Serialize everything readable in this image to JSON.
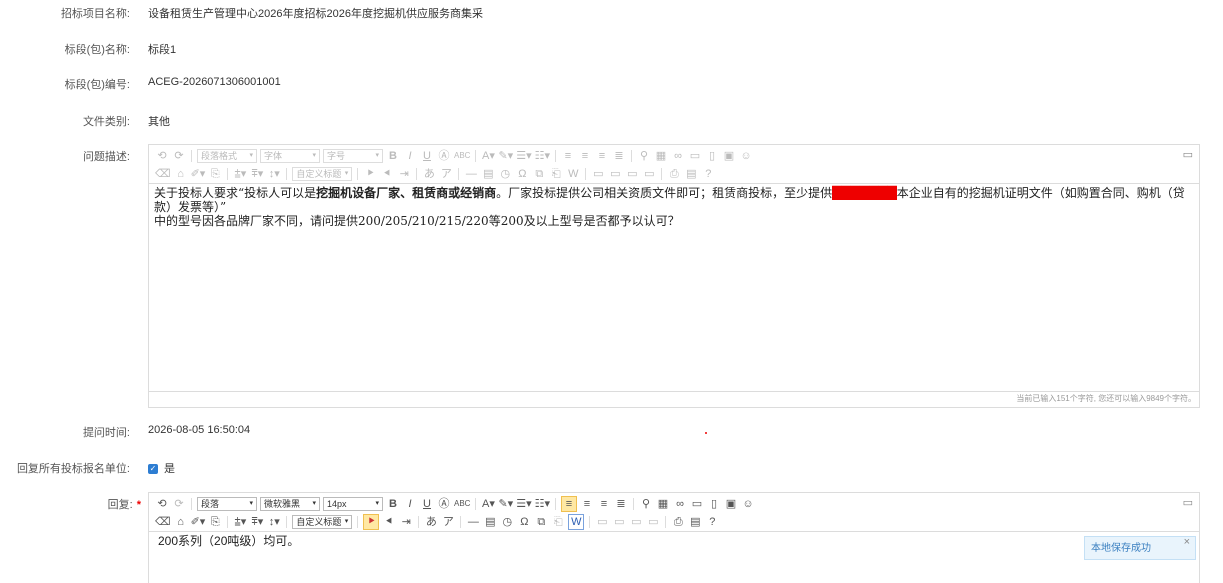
{
  "fields": {
    "project_name_label": "招标项目名称:",
    "project_name_value": "设备租赁生产管理中心2026年度招标2026年度挖掘机供应服务商集采",
    "section_name_label": "标段(包)名称:",
    "section_name_value": "标段1",
    "section_code_label": "标段(包)编号:",
    "section_code_value": "ACEG-2026071306001001",
    "file_type_label": "文件类别:",
    "file_type_value": "其他",
    "question_label": "问题描述:",
    "ask_time_label": "提问时间:",
    "ask_time_value": "2026-08-05 16:50:04",
    "reply_all_label": "回复所有投标报名单位:",
    "reply_all_value": "是",
    "reply_label": "回复:",
    "reply_required": "*"
  },
  "question_editor": {
    "toolbar": {
      "paragraph_placeholder": "段落格式",
      "font_placeholder": "字体",
      "size_placeholder": "字号",
      "custom_title": "自定义标题"
    },
    "content": {
      "part1": "关于投标人要求“投标人可以是",
      "bold": "挖掘机设备厂家、租赁商或经销商",
      "part2": "。厂家投标提供公司相关资质文件即可；租赁商投标，至少提供",
      "redacted": "███████",
      "part3": "本企业自有的挖掘机证明文件（如购置合同、购机（贷款）发票等）”",
      "line2": "中的型号因各品牌厂家不同，请问提供200/205/210/215/220等200及以上型号是否都予以认可？"
    },
    "counter": "当前已输入151个字符, 您还可以输入9849个字符。"
  },
  "reply_editor": {
    "toolbar": {
      "paragraph": "段落",
      "font": "微软雅黑",
      "size": "14px",
      "custom_title": "自定义标题"
    },
    "content": "200系列（20吨级）均可。"
  },
  "toast": {
    "message": "本地保存成功",
    "close": "×"
  },
  "colors": {
    "accent": "#2d7dd2",
    "required": "#e00000",
    "toast_bg": "#e9f4fc"
  }
}
